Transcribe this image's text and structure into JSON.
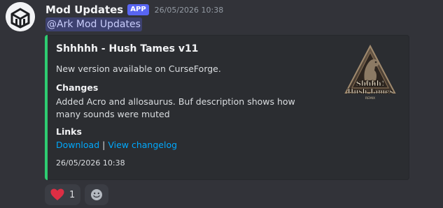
{
  "message": {
    "author": "Mod Updates",
    "badge": "APP",
    "timestamp": "26/05/2026 10:38",
    "mention": "@Ark Mod Updates"
  },
  "embed": {
    "accent_color": "#2ecc71",
    "title": "Shhhhh - Hush Tames v11",
    "description": "New version available on CurseForge.",
    "fields": [
      {
        "name": "Changes",
        "value": "Added Acro and allosaurus. Buf description shows how many sounds were muted"
      },
      {
        "name": "Links"
      }
    ],
    "links": {
      "download": "Download",
      "separator": "|",
      "changelog": "View changelog"
    },
    "footer_timestamp": "26/05/2026 10:38",
    "thumbnail": {
      "icon": "shhhh-dinosaur-logo",
      "line1": "Shhhh!",
      "line2": "Hush Tames",
      "line3": "REMIX"
    }
  },
  "reactions": [
    {
      "emoji": "heart-icon",
      "count": "1"
    }
  ],
  "add_reaction": {
    "icon": "add-reaction-icon"
  }
}
